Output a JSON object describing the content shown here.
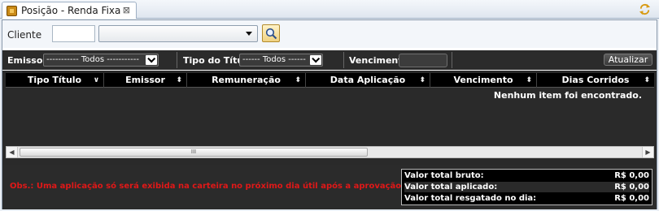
{
  "tab": {
    "title": "Posição - Renda Fixa",
    "icon": "folder-icon",
    "close_icon": "close-icon"
  },
  "window": {
    "refresh_icon": "refresh-icon"
  },
  "cliente": {
    "label": "Cliente",
    "code_value": "",
    "select_value": "",
    "search_icon": "search-icon"
  },
  "filters": {
    "emissor": {
      "label": "Emissor",
      "value": "----------- Todos -----------"
    },
    "tipo_titulo": {
      "label": "Tipo do Título",
      "value": "------ Todos ------"
    },
    "vencimento": {
      "label": "Vencimento",
      "value": ""
    },
    "atualizar_label": "Atualizar"
  },
  "table": {
    "columns": [
      {
        "label": "Tipo Título",
        "sort_icon": "chevron-down-icon"
      },
      {
        "label": "Emissor",
        "sort_icon": "sort-icon"
      },
      {
        "label": "Remuneração",
        "sort_icon": "sort-icon"
      },
      {
        "label": "Data Aplicação",
        "sort_icon": "sort-icon"
      },
      {
        "label": "Vencimento",
        "sort_icon": "sort-icon"
      },
      {
        "label": "Dias Corridos",
        "sort_icon": "sort-icon"
      }
    ],
    "empty_message": "Nenhum item foi encontrado.",
    "scrollbar_thumb_glyph": "III"
  },
  "footer": {
    "obs": "Obs.: Uma aplicação só será exibida na carteira no próximo dia útil após a aprovação.",
    "totals": [
      {
        "label": "Valor total bruto:",
        "value": "R$ 0,00"
      },
      {
        "label": "Valor total aplicado:",
        "value": "R$ 0,00"
      },
      {
        "label": "Valor total resgatado no dia:",
        "value": "R$ 0,00"
      }
    ]
  },
  "colors": {
    "obs_text": "#e01818",
    "header_bg": "#000000",
    "panel_bg": "#2b2b2b"
  }
}
